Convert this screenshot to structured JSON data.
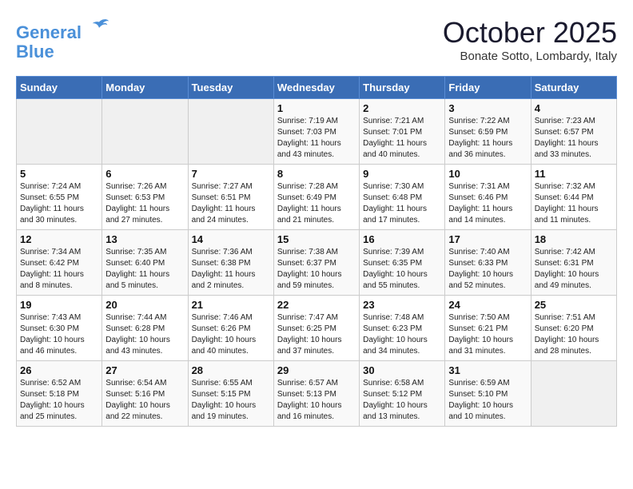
{
  "logo": {
    "line1": "General",
    "line2": "Blue"
  },
  "title": "October 2025",
  "subtitle": "Bonate Sotto, Lombardy, Italy",
  "weekdays": [
    "Sunday",
    "Monday",
    "Tuesday",
    "Wednesday",
    "Thursday",
    "Friday",
    "Saturday"
  ],
  "weeks": [
    [
      {
        "day": "",
        "info": ""
      },
      {
        "day": "",
        "info": ""
      },
      {
        "day": "",
        "info": ""
      },
      {
        "day": "1",
        "info": "Sunrise: 7:19 AM\nSunset: 7:03 PM\nDaylight: 11 hours\nand 43 minutes."
      },
      {
        "day": "2",
        "info": "Sunrise: 7:21 AM\nSunset: 7:01 PM\nDaylight: 11 hours\nand 40 minutes."
      },
      {
        "day": "3",
        "info": "Sunrise: 7:22 AM\nSunset: 6:59 PM\nDaylight: 11 hours\nand 36 minutes."
      },
      {
        "day": "4",
        "info": "Sunrise: 7:23 AM\nSunset: 6:57 PM\nDaylight: 11 hours\nand 33 minutes."
      }
    ],
    [
      {
        "day": "5",
        "info": "Sunrise: 7:24 AM\nSunset: 6:55 PM\nDaylight: 11 hours\nand 30 minutes."
      },
      {
        "day": "6",
        "info": "Sunrise: 7:26 AM\nSunset: 6:53 PM\nDaylight: 11 hours\nand 27 minutes."
      },
      {
        "day": "7",
        "info": "Sunrise: 7:27 AM\nSunset: 6:51 PM\nDaylight: 11 hours\nand 24 minutes."
      },
      {
        "day": "8",
        "info": "Sunrise: 7:28 AM\nSunset: 6:49 PM\nDaylight: 11 hours\nand 21 minutes."
      },
      {
        "day": "9",
        "info": "Sunrise: 7:30 AM\nSunset: 6:48 PM\nDaylight: 11 hours\nand 17 minutes."
      },
      {
        "day": "10",
        "info": "Sunrise: 7:31 AM\nSunset: 6:46 PM\nDaylight: 11 hours\nand 14 minutes."
      },
      {
        "day": "11",
        "info": "Sunrise: 7:32 AM\nSunset: 6:44 PM\nDaylight: 11 hours\nand 11 minutes."
      }
    ],
    [
      {
        "day": "12",
        "info": "Sunrise: 7:34 AM\nSunset: 6:42 PM\nDaylight: 11 hours\nand 8 minutes."
      },
      {
        "day": "13",
        "info": "Sunrise: 7:35 AM\nSunset: 6:40 PM\nDaylight: 11 hours\nand 5 minutes."
      },
      {
        "day": "14",
        "info": "Sunrise: 7:36 AM\nSunset: 6:38 PM\nDaylight: 11 hours\nand 2 minutes."
      },
      {
        "day": "15",
        "info": "Sunrise: 7:38 AM\nSunset: 6:37 PM\nDaylight: 10 hours\nand 59 minutes."
      },
      {
        "day": "16",
        "info": "Sunrise: 7:39 AM\nSunset: 6:35 PM\nDaylight: 10 hours\nand 55 minutes."
      },
      {
        "day": "17",
        "info": "Sunrise: 7:40 AM\nSunset: 6:33 PM\nDaylight: 10 hours\nand 52 minutes."
      },
      {
        "day": "18",
        "info": "Sunrise: 7:42 AM\nSunset: 6:31 PM\nDaylight: 10 hours\nand 49 minutes."
      }
    ],
    [
      {
        "day": "19",
        "info": "Sunrise: 7:43 AM\nSunset: 6:30 PM\nDaylight: 10 hours\nand 46 minutes."
      },
      {
        "day": "20",
        "info": "Sunrise: 7:44 AM\nSunset: 6:28 PM\nDaylight: 10 hours\nand 43 minutes."
      },
      {
        "day": "21",
        "info": "Sunrise: 7:46 AM\nSunset: 6:26 PM\nDaylight: 10 hours\nand 40 minutes."
      },
      {
        "day": "22",
        "info": "Sunrise: 7:47 AM\nSunset: 6:25 PM\nDaylight: 10 hours\nand 37 minutes."
      },
      {
        "day": "23",
        "info": "Sunrise: 7:48 AM\nSunset: 6:23 PM\nDaylight: 10 hours\nand 34 minutes."
      },
      {
        "day": "24",
        "info": "Sunrise: 7:50 AM\nSunset: 6:21 PM\nDaylight: 10 hours\nand 31 minutes."
      },
      {
        "day": "25",
        "info": "Sunrise: 7:51 AM\nSunset: 6:20 PM\nDaylight: 10 hours\nand 28 minutes."
      }
    ],
    [
      {
        "day": "26",
        "info": "Sunrise: 6:52 AM\nSunset: 5:18 PM\nDaylight: 10 hours\nand 25 minutes."
      },
      {
        "day": "27",
        "info": "Sunrise: 6:54 AM\nSunset: 5:16 PM\nDaylight: 10 hours\nand 22 minutes."
      },
      {
        "day": "28",
        "info": "Sunrise: 6:55 AM\nSunset: 5:15 PM\nDaylight: 10 hours\nand 19 minutes."
      },
      {
        "day": "29",
        "info": "Sunrise: 6:57 AM\nSunset: 5:13 PM\nDaylight: 10 hours\nand 16 minutes."
      },
      {
        "day": "30",
        "info": "Sunrise: 6:58 AM\nSunset: 5:12 PM\nDaylight: 10 hours\nand 13 minutes."
      },
      {
        "day": "31",
        "info": "Sunrise: 6:59 AM\nSunset: 5:10 PM\nDaylight: 10 hours\nand 10 minutes."
      },
      {
        "day": "",
        "info": ""
      }
    ]
  ]
}
